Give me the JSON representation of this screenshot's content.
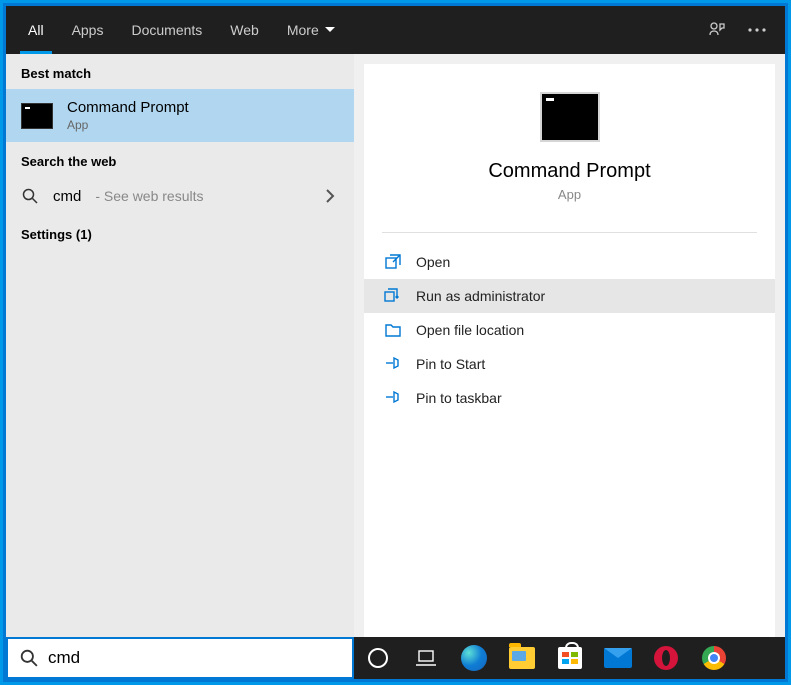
{
  "topbar": {
    "tabs": {
      "all": "All",
      "apps": "Apps",
      "documents": "Documents",
      "web": "Web",
      "more": "More"
    }
  },
  "left": {
    "best_match_label": "Best match",
    "match": {
      "title": "Command Prompt",
      "subtitle": "App"
    },
    "search_web_label": "Search the web",
    "web": {
      "term": "cmd",
      "suffix": " - See web results"
    },
    "settings_label": "Settings (1)"
  },
  "preview": {
    "title": "Command Prompt",
    "subtitle": "App",
    "actions": {
      "open": "Open",
      "run_admin": "Run as administrator",
      "open_location": "Open file location",
      "pin_start": "Pin to Start",
      "pin_taskbar": "Pin to taskbar"
    }
  },
  "search": {
    "value": "cmd"
  }
}
